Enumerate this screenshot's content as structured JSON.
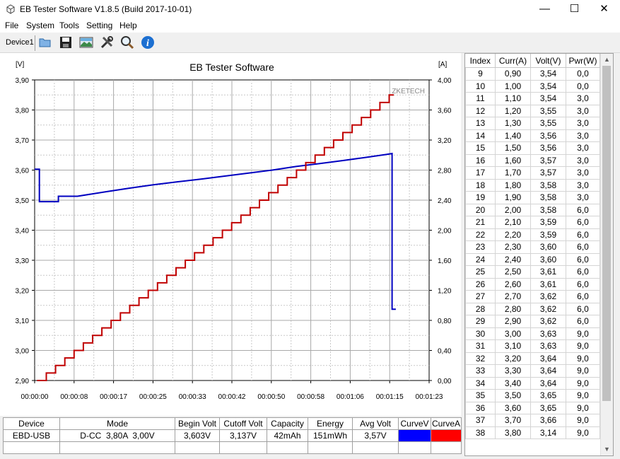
{
  "window": {
    "title": "EB Tester Software V1.8.5 (Build 2017-10-01)",
    "minimize": "—",
    "maximize": "☐",
    "close": "✕"
  },
  "menu": [
    "File",
    "System",
    "Tools",
    "Setting",
    "Help"
  ],
  "toolbar": {
    "device": "Device1",
    "icons": [
      "open-folder-icon",
      "save-icon",
      "picture-icon",
      "tools-icon",
      "search-icon",
      "info-icon"
    ]
  },
  "chart_data": {
    "type": "line",
    "title": "EB Tester Software",
    "watermark": "ZKETECH",
    "left_unit": "[V]",
    "right_unit": "[A]",
    "x_ticks": [
      "00:00:00",
      "00:00:08",
      "00:00:17",
      "00:00:25",
      "00:00:33",
      "00:00:42",
      "00:00:50",
      "00:00:58",
      "00:01:06",
      "00:01:15",
      "00:01:23"
    ],
    "xlim_seconds": [
      0,
      83
    ],
    "y_left_ticks": [
      "3,90",
      "3,80",
      "3,70",
      "3,60",
      "3,50",
      "3,40",
      "3,30",
      "3,20",
      "3,10",
      "3,00",
      "2,90"
    ],
    "ylim_left": [
      2.9,
      3.9
    ],
    "y_right_ticks": [
      "4,00",
      "3,60",
      "3,20",
      "2,80",
      "2,40",
      "2,00",
      "1,60",
      "1,20",
      "0,80",
      "0,40",
      "0,00"
    ],
    "ylim_right": [
      0.0,
      4.0
    ],
    "grid": true,
    "series": [
      {
        "name": "CurveV",
        "color": "#0000c0",
        "axis": "left",
        "points": [
          [
            0,
            3.603
          ],
          [
            1,
            3.603
          ],
          [
            1,
            3.495
          ],
          [
            5,
            3.495
          ],
          [
            5,
            3.513
          ],
          [
            9,
            3.513
          ],
          [
            15,
            3.528
          ],
          [
            20,
            3.54
          ],
          [
            25,
            3.551
          ],
          [
            30,
            3.561
          ],
          [
            35,
            3.57
          ],
          [
            40,
            3.58
          ],
          [
            45,
            3.59
          ],
          [
            50,
            3.6
          ],
          [
            55,
            3.612
          ],
          [
            60,
            3.622
          ],
          [
            65,
            3.632
          ],
          [
            70,
            3.643
          ],
          [
            74,
            3.652
          ],
          [
            75.2,
            3.655
          ],
          [
            75.2,
            3.137
          ],
          [
            76,
            3.137
          ]
        ]
      },
      {
        "name": "CurveA",
        "color": "#c00000",
        "axis": "right",
        "steps": {
          "start_time": 0.5,
          "step_seconds": 1.95,
          "start_current": 0.0,
          "step_current": 0.1,
          "end_current": 3.8
        }
      }
    ]
  },
  "info_table": {
    "headers": [
      "Device",
      "Mode",
      "Begin Volt",
      "Cutoff Volt",
      "Capacity",
      "Energy",
      "Avg Volt",
      "CurveV",
      "CurveA"
    ],
    "row": [
      "EBD-USB",
      "D-CC  3,80A  3,00V",
      "3,603V",
      "3,137V",
      "42mAh",
      "151mWh",
      "3,57V",
      "",
      ""
    ],
    "curve_colors": [
      "#0000ff",
      "#ff0000"
    ]
  },
  "list": {
    "headers": [
      "Index",
      "Curr(A)",
      "Volt(V)",
      "Pwr(W)"
    ],
    "rows": [
      [
        "9",
        "0,90",
        "3,54",
        "0,0"
      ],
      [
        "10",
        "1,00",
        "3,54",
        "0,0"
      ],
      [
        "11",
        "1,10",
        "3,54",
        "3,0"
      ],
      [
        "12",
        "1,20",
        "3,55",
        "3,0"
      ],
      [
        "13",
        "1,30",
        "3,55",
        "3,0"
      ],
      [
        "14",
        "1,40",
        "3,56",
        "3,0"
      ],
      [
        "15",
        "1,50",
        "3,56",
        "3,0"
      ],
      [
        "16",
        "1,60",
        "3,57",
        "3,0"
      ],
      [
        "17",
        "1,70",
        "3,57",
        "3,0"
      ],
      [
        "18",
        "1,80",
        "3,58",
        "3,0"
      ],
      [
        "19",
        "1,90",
        "3,58",
        "3,0"
      ],
      [
        "20",
        "2,00",
        "3,58",
        "6,0"
      ],
      [
        "21",
        "2,10",
        "3,59",
        "6,0"
      ],
      [
        "22",
        "2,20",
        "3,59",
        "6,0"
      ],
      [
        "23",
        "2,30",
        "3,60",
        "6,0"
      ],
      [
        "24",
        "2,40",
        "3,60",
        "6,0"
      ],
      [
        "25",
        "2,50",
        "3,61",
        "6,0"
      ],
      [
        "26",
        "2,60",
        "3,61",
        "6,0"
      ],
      [
        "27",
        "2,70",
        "3,62",
        "6,0"
      ],
      [
        "28",
        "2,80",
        "3,62",
        "6,0"
      ],
      [
        "29",
        "2,90",
        "3,62",
        "6,0"
      ],
      [
        "30",
        "3,00",
        "3,63",
        "9,0"
      ],
      [
        "31",
        "3,10",
        "3,63",
        "9,0"
      ],
      [
        "32",
        "3,20",
        "3,64",
        "9,0"
      ],
      [
        "33",
        "3,30",
        "3,64",
        "9,0"
      ],
      [
        "34",
        "3,40",
        "3,64",
        "9,0"
      ],
      [
        "35",
        "3,50",
        "3,65",
        "9,0"
      ],
      [
        "36",
        "3,60",
        "3,65",
        "9,0"
      ],
      [
        "37",
        "3,70",
        "3,66",
        "9,0"
      ],
      [
        "38",
        "3,80",
        "3,14",
        "9,0"
      ]
    ]
  }
}
